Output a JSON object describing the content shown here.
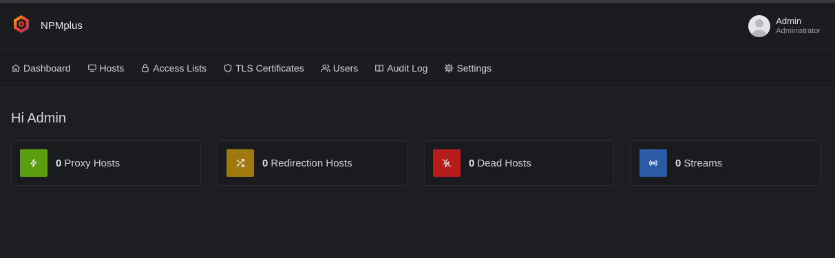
{
  "app": {
    "name": "NPMplus"
  },
  "user": {
    "name": "Admin",
    "role": "Administrator"
  },
  "nav": [
    {
      "label": "Dashboard",
      "icon": "home-icon"
    },
    {
      "label": "Hosts",
      "icon": "monitor-icon"
    },
    {
      "label": "Access Lists",
      "icon": "lock-icon"
    },
    {
      "label": "TLS Certificates",
      "icon": "shield-icon"
    },
    {
      "label": "Users",
      "icon": "users-icon"
    },
    {
      "label": "Audit Log",
      "icon": "book-icon"
    },
    {
      "label": "Settings",
      "icon": "gear-icon"
    }
  ],
  "greeting": "Hi Admin",
  "cards": [
    {
      "count": "0",
      "label": "Proxy Hosts",
      "icon": "bolt-icon",
      "color": "#5a9e0f"
    },
    {
      "count": "0",
      "label": "Redirection Hosts",
      "icon": "shuffle-icon",
      "color": "#9e7a0e"
    },
    {
      "count": "0",
      "label": "Dead Hosts",
      "icon": "bolt-off-icon",
      "color": "#b51c1c"
    },
    {
      "count": "0",
      "label": "Streams",
      "icon": "broadcast-icon",
      "color": "#2c5ba6"
    }
  ]
}
